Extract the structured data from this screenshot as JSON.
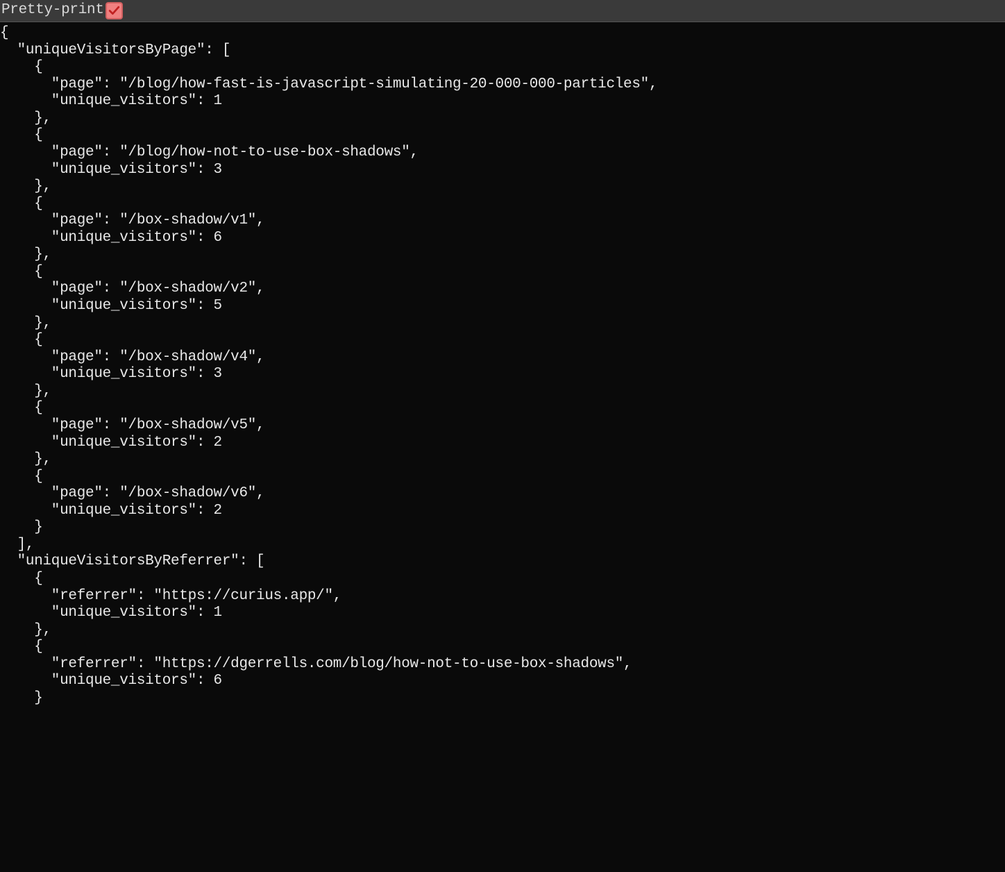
{
  "header": {
    "label": "Pretty-print",
    "checked": true
  },
  "json_data": {
    "uniqueVisitorsByPage": [
      {
        "page": "/blog/how-fast-is-javascript-simulating-20-000-000-particles",
        "unique_visitors": 1
      },
      {
        "page": "/blog/how-not-to-use-box-shadows",
        "unique_visitors": 3
      },
      {
        "page": "/box-shadow/v1",
        "unique_visitors": 6
      },
      {
        "page": "/box-shadow/v2",
        "unique_visitors": 5
      },
      {
        "page": "/box-shadow/v4",
        "unique_visitors": 3
      },
      {
        "page": "/box-shadow/v5",
        "unique_visitors": 2
      },
      {
        "page": "/box-shadow/v6",
        "unique_visitors": 2
      }
    ],
    "uniqueVisitorsByReferrer": [
      {
        "referrer": "https://curius.app/",
        "unique_visitors": 1
      },
      {
        "referrer": "https://dgerrells.com/blog/how-not-to-use-box-shadows",
        "unique_visitors": 6
      }
    ]
  }
}
